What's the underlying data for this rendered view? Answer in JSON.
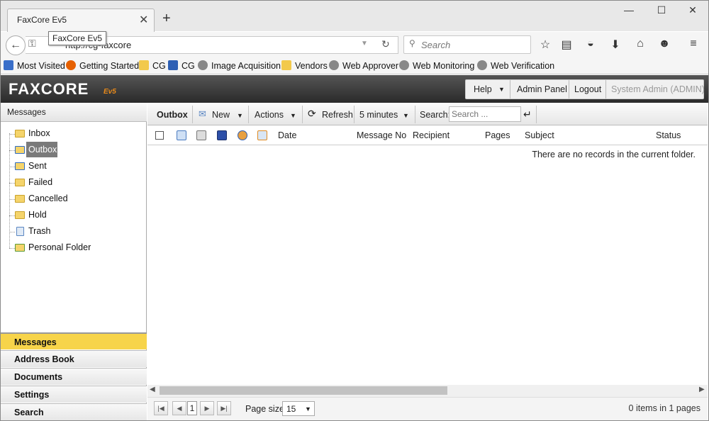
{
  "browser": {
    "tab_title": "FaxCore Ev5",
    "tooltip": "FaxCore Ev5",
    "url": "http://cg-faxcore",
    "search_placeholder": "Search",
    "window_buttons": [
      "—",
      "☐",
      "✕"
    ],
    "bookmarks": [
      {
        "label": "Most Visited",
        "icon": "star-folder-icon",
        "color": "#3a6fc9"
      },
      {
        "label": "Getting Started",
        "icon": "firefox-icon",
        "color": "#e66000"
      },
      {
        "label": "CG",
        "icon": "folder-icon",
        "color": "#f2c94c"
      },
      {
        "label": "CG",
        "icon": "grid-app-icon",
        "color": "#2d5fb4"
      },
      {
        "label": "Image Acquisition",
        "icon": "globe-icon",
        "color": "#888888"
      },
      {
        "label": "Vendors",
        "icon": "folder-icon",
        "color": "#f2c94c"
      },
      {
        "label": "Web Approver",
        "icon": "globe-icon",
        "color": "#888888"
      },
      {
        "label": "Web Monitoring",
        "icon": "globe-icon",
        "color": "#888888"
      },
      {
        "label": "Web Verification",
        "icon": "globe-icon",
        "color": "#888888"
      }
    ]
  },
  "app": {
    "logo": "FAXCORE",
    "logo_version": "Ev5",
    "header_buttons": {
      "help": "Help",
      "admin_panel": "Admin Panel",
      "logout": "Logout",
      "user": "System Admin (ADMIN)"
    },
    "left_panel": {
      "title": "Messages",
      "folders": [
        {
          "label": "Inbox",
          "icon": "inbox-folder-icon",
          "selected": false
        },
        {
          "label": "Outbox",
          "icon": "outbox-folder-icon",
          "selected": true
        },
        {
          "label": "Sent",
          "icon": "sent-folder-icon",
          "selected": false
        },
        {
          "label": "Failed",
          "icon": "folder-icon",
          "selected": false
        },
        {
          "label": "Cancelled",
          "icon": "folder-icon",
          "selected": false
        },
        {
          "label": "Hold",
          "icon": "folder-icon",
          "selected": false
        },
        {
          "label": "Trash",
          "icon": "trash-icon",
          "selected": false
        },
        {
          "label": "Personal Folder",
          "icon": "personal-folder-icon",
          "selected": false
        }
      ],
      "nav": [
        {
          "label": "Messages",
          "active": true
        },
        {
          "label": "Address Book",
          "active": false
        },
        {
          "label": "Documents",
          "active": false
        },
        {
          "label": "Settings",
          "active": false
        },
        {
          "label": "Search",
          "active": false
        }
      ]
    },
    "toolbar": {
      "folder": "Outbox",
      "new": "New",
      "actions": "Actions",
      "refresh": "Refresh",
      "interval": "5 minutes",
      "search_label": "Search:",
      "search_placeholder": "Search ..."
    },
    "columns": [
      "Date",
      "Message No",
      "Recipient",
      "Pages",
      "Subject",
      "Status"
    ],
    "empty_message": "There are no records in the current folder.",
    "pager": {
      "page": "1",
      "page_size_label": "Page size:",
      "page_size": "15",
      "info": "0 items in 1 pages"
    },
    "colors": {
      "active_nav": "#f7d44a",
      "header_bg": "#3a3a3a",
      "selected_folder": "#7a7a7a"
    }
  }
}
